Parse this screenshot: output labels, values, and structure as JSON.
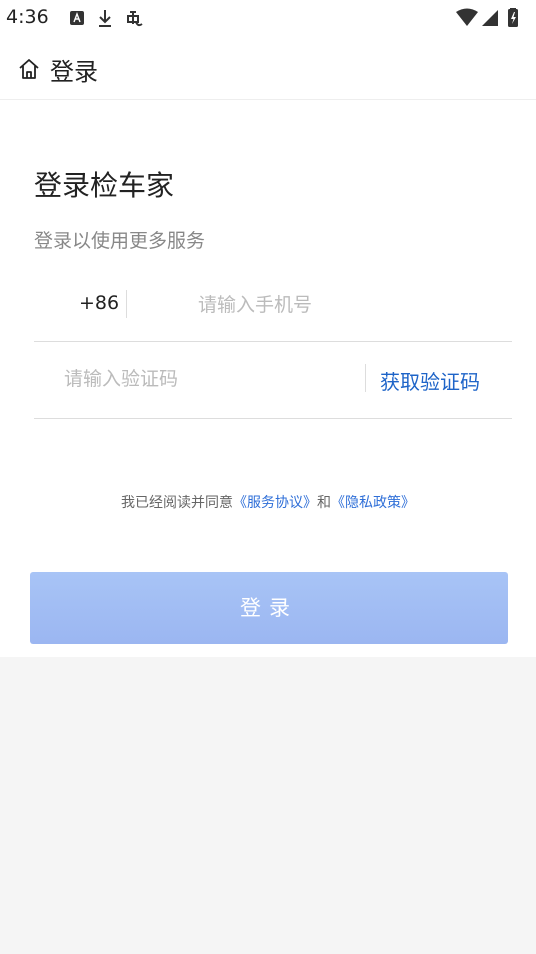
{
  "status_bar": {
    "time": "4:36",
    "left_icons": [
      "notification-a-icon",
      "download-icon",
      "bug-icon"
    ],
    "right_icons": [
      "wifi-icon",
      "signal-icon",
      "battery-charging-icon"
    ]
  },
  "app_bar": {
    "icon": "home-icon",
    "title": "登录"
  },
  "login": {
    "heading": "登录检车家",
    "subheading": "登录以使用更多服务",
    "country_code": "+86",
    "phone_placeholder": "请输入手机号",
    "phone_value": "",
    "code_placeholder": "请输入验证码",
    "code_value": "",
    "get_code_label": "获取验证码",
    "agreement": {
      "prefix": "我已经阅读并同意",
      "service_link": "《服务协议》",
      "and": "和",
      "privacy_link": "《隐私政策》"
    },
    "submit_label": "登录"
  },
  "colors": {
    "link": "#2f6fd8",
    "get_code": "#1e64c8",
    "button_disabled": "#a2bdf4",
    "page_background": "#f5f5f5"
  }
}
